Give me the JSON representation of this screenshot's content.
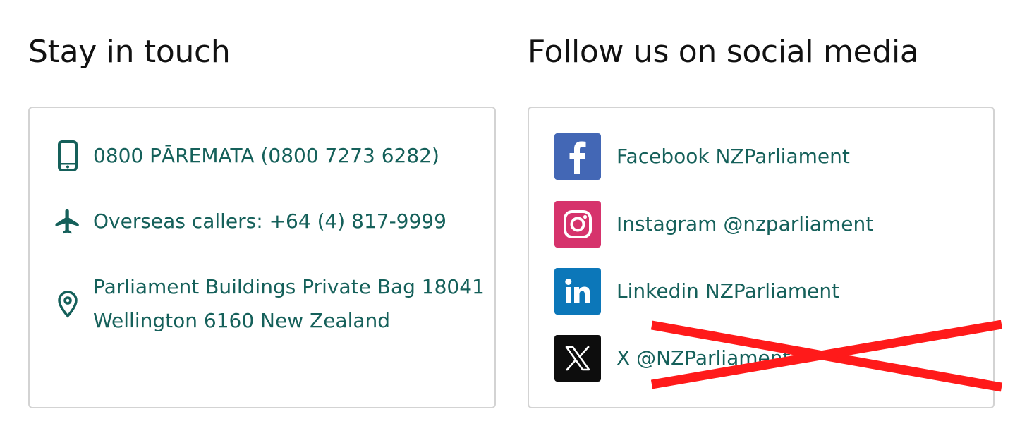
{
  "contact": {
    "heading": "Stay in touch",
    "phone": {
      "label": "0800 PĀREMATA (0800 7273 6282)",
      "icon": "mobile-phone-icon"
    },
    "overseas": {
      "label": "Overseas callers: +64 (4) 817-9999",
      "icon": "airplane-icon"
    },
    "address": {
      "line1": "Parliament Buildings Private Bag 18041",
      "line2": "Wellington 6160 New Zealand",
      "icon": "location-pin-icon"
    }
  },
  "social": {
    "heading": "Follow us on social media",
    "items": [
      {
        "label": "Facebook NZParliament",
        "icon": "facebook-icon",
        "color": "#4367b5"
      },
      {
        "label": "Instagram @nzparliament",
        "icon": "instagram-icon",
        "color": "#d6336c"
      },
      {
        "label": "Linkedin NZParliament",
        "icon": "linkedin-icon",
        "color": "#0c77b9"
      },
      {
        "label": "X @NZParliament",
        "icon": "x-icon",
        "color": "#0d0d0d"
      }
    ]
  },
  "overlay": {
    "strikethrough": "red-cross-mark",
    "color": "#ff1a1a"
  },
  "colors": {
    "link": "#15605a",
    "heading": "#111111",
    "border": "#d3d3d3"
  }
}
